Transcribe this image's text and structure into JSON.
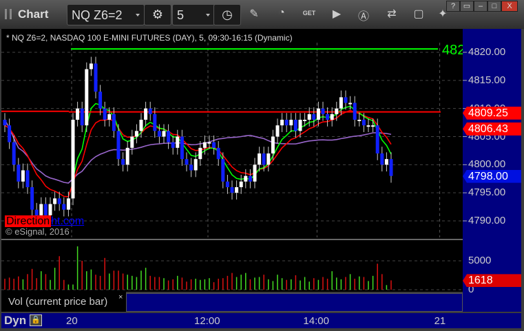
{
  "toolbar": {
    "title": "Chart",
    "symbol": "NQ Z6=2",
    "interval": "5",
    "icons": [
      "gear-icon",
      "clock-icon",
      "pencil-icon",
      "chart-refresh-icon",
      "get-icon",
      "play-icon",
      "alert-icon",
      "link-icon",
      "comment-icon",
      "twitter-icon"
    ]
  },
  "window_buttons": [
    "?",
    "▭",
    "–",
    "□",
    "X"
  ],
  "chart": {
    "header": "* NQ Z6=2, NASDAQ 100 E-MINI FUTURES (DAY), 5, 09:30-16:15 (Dynamic)",
    "green_level_label": "482",
    "watermark_red": "Direction",
    "watermark_blue": "ht.com",
    "copyright": "© eSignal, 2016",
    "price_ticks": [
      "4820.00",
      "4815.00",
      "4810.00",
      "4805.00",
      "4800.00",
      "4795.00",
      "4790.00"
    ],
    "tags": [
      {
        "label": "4809.25",
        "color": "#ff0000",
        "price": 4809.25
      },
      {
        "label": "4806.43",
        "color": "#ff0000",
        "price": 4806.43
      },
      {
        "label": "4798.00",
        "color": "#0010e0",
        "price": 4798.0
      }
    ],
    "green_level": 4820.6,
    "red_level": 4809.4,
    "ymin": 4787.2,
    "ymax": 4822.8,
    "closes": [
      4807,
      4804,
      4800,
      4797,
      4799,
      4796,
      4792,
      4791,
      4793,
      4791,
      4793,
      4794,
      4793,
      4792,
      4794,
      4808,
      4810,
      4807,
      4817,
      4818,
      4813,
      4810,
      4808,
      4809,
      4806,
      4801,
      4800,
      4803,
      4805,
      4806,
      4808,
      4810,
      4809,
      4806,
      4805,
      4806,
      4804,
      4803,
      4805,
      4801,
      4800,
      4799,
      4801,
      4803,
      4804,
      4804,
      4803,
      4801,
      4797,
      4796,
      4795,
      4796,
      4797,
      4798,
      4797,
      4800,
      4802,
      4800,
      4802,
      4805,
      4807,
      4808,
      4807,
      4808,
      4806,
      4808,
      4808,
      4809,
      4808,
      4810,
      4809,
      4808,
      4809,
      4810,
      4812,
      4811,
      4811,
      4808,
      4808,
      4807,
      4807,
      4807,
      4802,
      4800,
      4801,
      4798
    ]
  },
  "volume": {
    "label": "Vol (current price bar)",
    "close_x": "×",
    "ticks": [
      "5000",
      "0"
    ],
    "current": "1618",
    "values": [
      1900,
      2100,
      1900,
      2300,
      1800,
      2700,
      3600,
      2000,
      3200,
      2700,
      1700,
      3800,
      5800,
      1700,
      900,
      900,
      7500,
      5000,
      3200,
      3500,
      2600,
      2400,
      5500,
      2800,
      3300,
      3300,
      2800,
      2600,
      2400,
      2200,
      3300,
      3800,
      2400,
      2200,
      2200,
      2000,
      1600,
      1800,
      2400,
      2100,
      1400,
      1800,
      1900,
      1700,
      1800,
      2000,
      1300,
      1900,
      2000,
      2400,
      2900,
      2200,
      2600,
      2900,
      1800,
      2100,
      2200,
      2600,
      1800,
      1500,
      2600,
      2000,
      1700,
      1800,
      2500,
      1600,
      2200,
      1400,
      2000,
      1700,
      2200,
      1900,
      3200,
      2100,
      1800,
      2200,
      2700,
      1900,
      2300,
      2200,
      1500,
      2400,
      4500,
      2700,
      800,
      1618
    ]
  },
  "time_axis": {
    "mode": "Dyn",
    "ticks": [
      {
        "label": "20",
        "bar": 15
      },
      {
        "label": "12:00",
        "bar": 45
      },
      {
        "label": "14:00",
        "bar": 69
      },
      {
        "label": "21",
        "bar": 96
      }
    ]
  }
}
